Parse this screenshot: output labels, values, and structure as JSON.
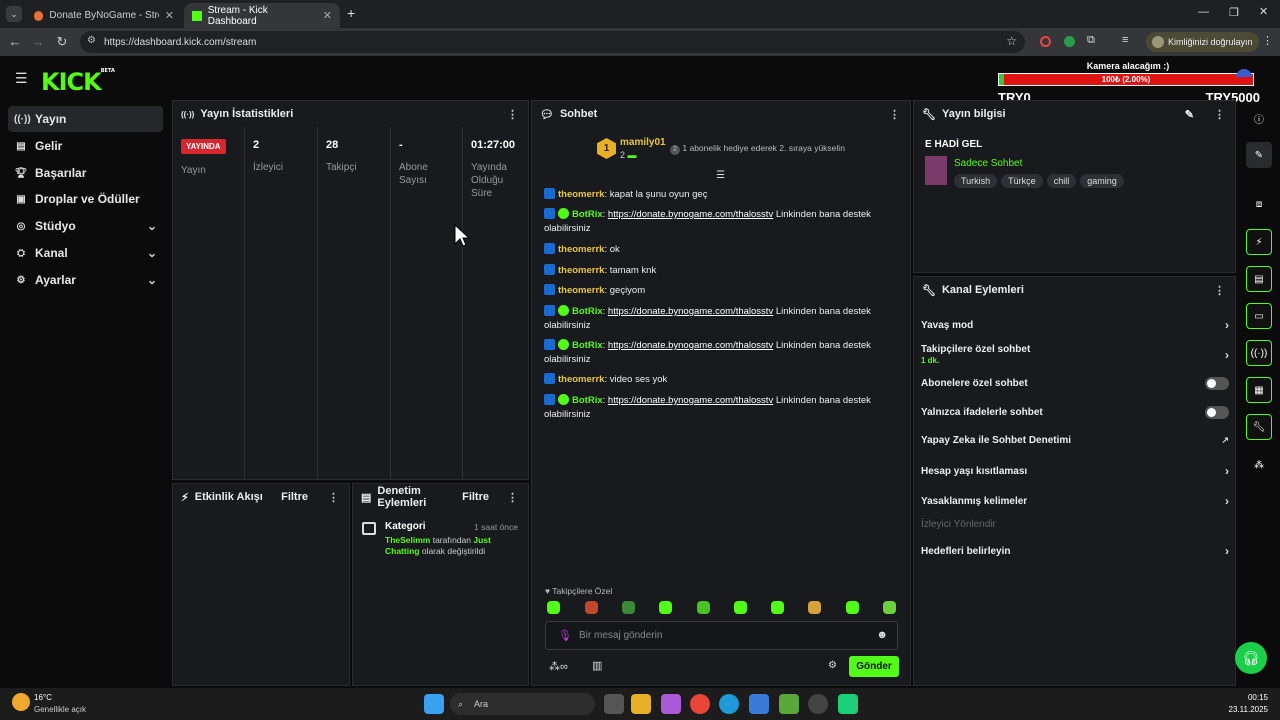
{
  "browser": {
    "tabs": [
      {
        "title": "Donate ByNoGame - Streamer"
      },
      {
        "title": "Stream - Kick Dashboard"
      }
    ],
    "url": "https://dashboard.kick.com/stream",
    "profile_label": "Kimliğinizi doğrulayın"
  },
  "app": {
    "logo": "KICK",
    "logo_badge": "BETA"
  },
  "goal": {
    "title": "Kamera alacağım :)",
    "bar_text": "100₺ (2.00%)",
    "progress_percent": 2,
    "min": "TRY0",
    "max": "TRY5000"
  },
  "sidebar": {
    "items": [
      {
        "label": "Yayın",
        "icon": "broadcast-icon"
      },
      {
        "label": "Gelir",
        "icon": "chart-icon"
      },
      {
        "label": "Başarılar",
        "icon": "trophy-icon"
      },
      {
        "label": "Droplar ve Ödüller",
        "icon": "gift-icon"
      },
      {
        "label": "Stüdyo",
        "icon": "studio-icon"
      },
      {
        "label": "Kanal",
        "icon": "channel-icon"
      },
      {
        "label": "Ayarlar",
        "icon": "gear-icon"
      }
    ]
  },
  "stats": {
    "title": "Yayın İstatistikleri",
    "live_badge": "YAYINDA",
    "live_label": "Yayın",
    "viewers": {
      "value": "2",
      "label": "İzleyici"
    },
    "followers": {
      "value": "28",
      "label": "Takipçi"
    },
    "subs": {
      "value": "-",
      "label": "Abone Sayısı"
    },
    "duration": {
      "value": "01:27:00",
      "label": "Yayında Olduğu Süre"
    }
  },
  "activity": {
    "title": "Etkinlik Akışı",
    "filter": "Filtre"
  },
  "moderation": {
    "title": "Denetim Eylemleri",
    "filter": "Filtre",
    "entry": {
      "title": "Kategori",
      "time": "1 saat önce",
      "user": "TheSelimm",
      "mid": " tarafından ",
      "category": "Just Chatting",
      "end": " olarak değiştirildi"
    }
  },
  "chat": {
    "title": "Sohbet",
    "top_gifter": {
      "rank": "1",
      "name": "mamily01",
      "count": "2"
    },
    "promo": "1 abonelik hediye ederek 2. sıraya yükselin",
    "messages": [
      {
        "user": "theomerrk",
        "text": "kapat la şunu oyun geç"
      },
      {
        "user": "BotRix",
        "link": "https://donate.bynogame.com/thalosstv",
        "text": " Linkinden bana destek olabilirsiniz"
      },
      {
        "user": "theomerrk",
        "text": "ok"
      },
      {
        "user": "theomerrk",
        "text": "tamam knk"
      },
      {
        "user": "theomerrk",
        "text": "geçiyom"
      },
      {
        "user": "BotRix",
        "link": "https://donate.bynogame.com/thalosstv",
        "text": " Linkinden bana destek olabilirsiniz"
      },
      {
        "user": "BotRix",
        "link": "https://donate.bynogame.com/thalosstv",
        "text": " Linkinden bana destek olabilirsiniz"
      },
      {
        "user": "theomerrk",
        "text": "video ses yok"
      },
      {
        "user": "BotRix",
        "link": "https://donate.bynogame.com/thalosstv",
        "text": " Linkinden bana destek olabilirsiniz"
      }
    ],
    "followers_only": "Takipçilere Özel",
    "placeholder": "Bir mesaj gönderin",
    "send": "Gönder"
  },
  "stream_info": {
    "title": "Yayın bilgisi",
    "stream_title": "E HADİ GEL",
    "category": "Sadece Sohbet",
    "tags": [
      "Turkish",
      "Türkçe",
      "chill",
      "gaming"
    ]
  },
  "channel_actions": {
    "title": "Kanal Eylemleri",
    "items": [
      {
        "label": "Yavaş mod"
      },
      {
        "label": "Takipçilere özel sohbet",
        "sub": "1 dk."
      },
      {
        "label": "Abonelere özel sohbet"
      },
      {
        "label": "Yalnızca ifadelerle sohbet"
      },
      {
        "label": "Yapay Zeka ile Sohbet Denetimi"
      },
      {
        "label": "Hesap yaşı kısıtlaması"
      },
      {
        "label": "Yasaklanmış kelimeler"
      },
      {
        "label": "İzleyici Yönlendir"
      },
      {
        "label": "Hedefleri belirleyin"
      }
    ]
  },
  "taskbar": {
    "temp": "16°C",
    "weather": "Genellikle açık",
    "search": "Ara",
    "time": "00:15",
    "date": "23.11.2025"
  }
}
